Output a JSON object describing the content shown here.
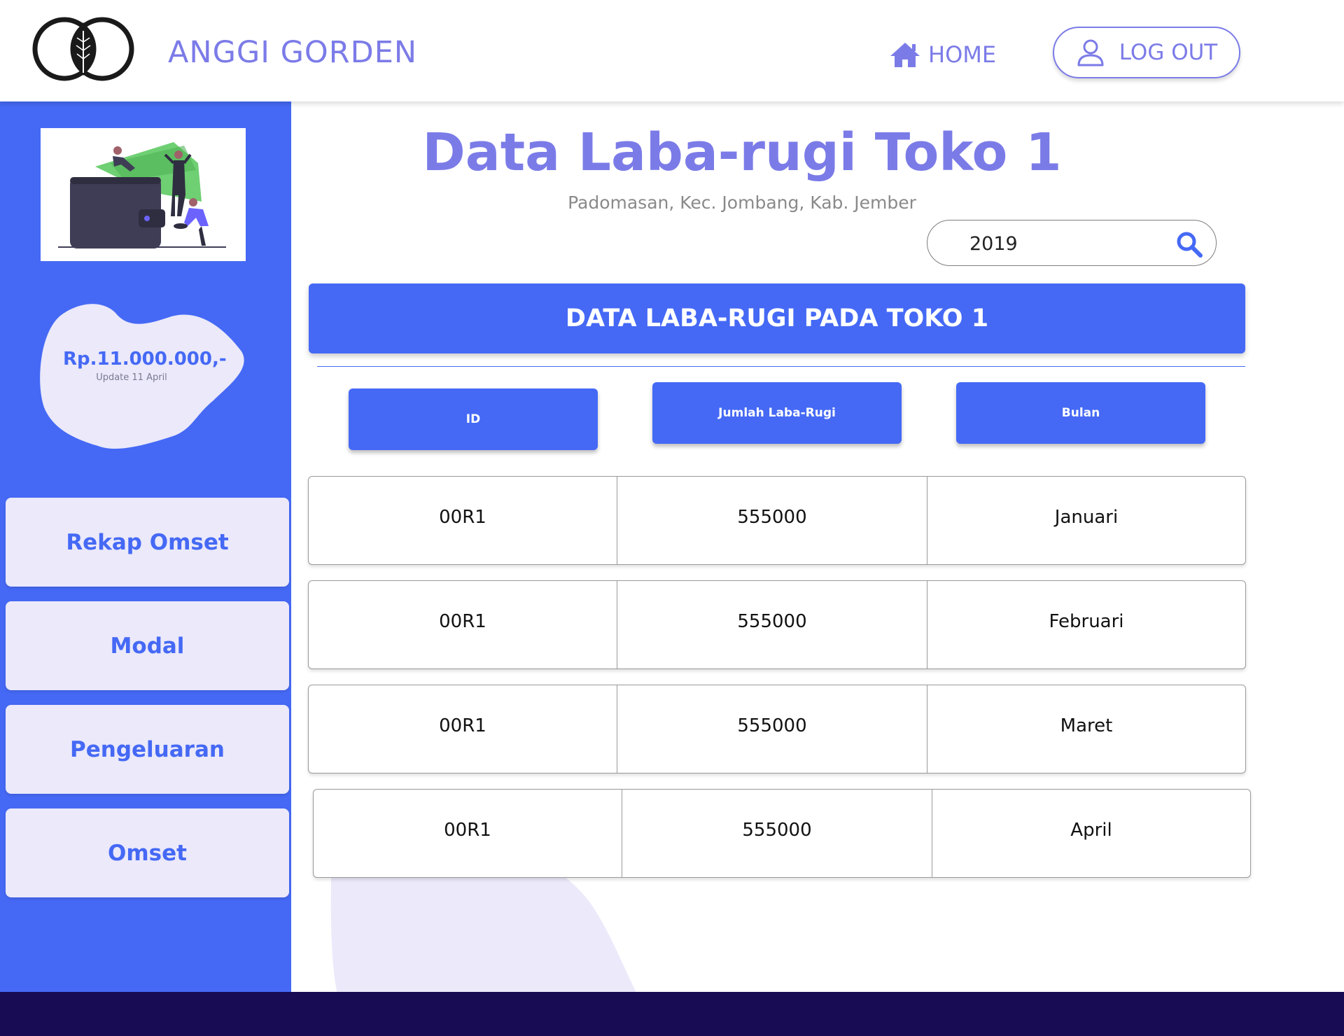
{
  "header": {
    "brand": "ANGGI GORDEN",
    "home_label": "HOME",
    "logout_label": "LOG OUT"
  },
  "sidebar": {
    "balance_amount": "Rp.11.000.000,-",
    "balance_update": "Update 11 April",
    "menu": [
      "Rekap Omset",
      "Modal",
      "Pengeluaran",
      "Omset"
    ]
  },
  "main": {
    "title": "Data Laba-rugi Toko 1",
    "subtitle": "Padomasan, Kec. Jombang, Kab. Jember",
    "search_value": "2019",
    "banner": "DATA LABA-RUGI PADA TOKO 1",
    "columns": [
      "ID",
      "Jumlah Laba-Rugi",
      "Bulan"
    ],
    "rows": [
      {
        "id": "00R1",
        "amount": "555000",
        "month": "Januari"
      },
      {
        "id": "00R1",
        "amount": "555000",
        "month": "Februari"
      },
      {
        "id": "00R1",
        "amount": "555000",
        "month": "Maret"
      },
      {
        "id": "00R1",
        "amount": "555000",
        "month": "April"
      }
    ]
  },
  "colors": {
    "primary": "#4569f5",
    "accent": "#7b7be8",
    "footer": "#180c55",
    "menu_bg": "#ebe9fa"
  },
  "icons": {
    "logo": "leaf-circles-logo",
    "home": "home-icon",
    "logout": "user-icon",
    "search": "search-icon"
  }
}
